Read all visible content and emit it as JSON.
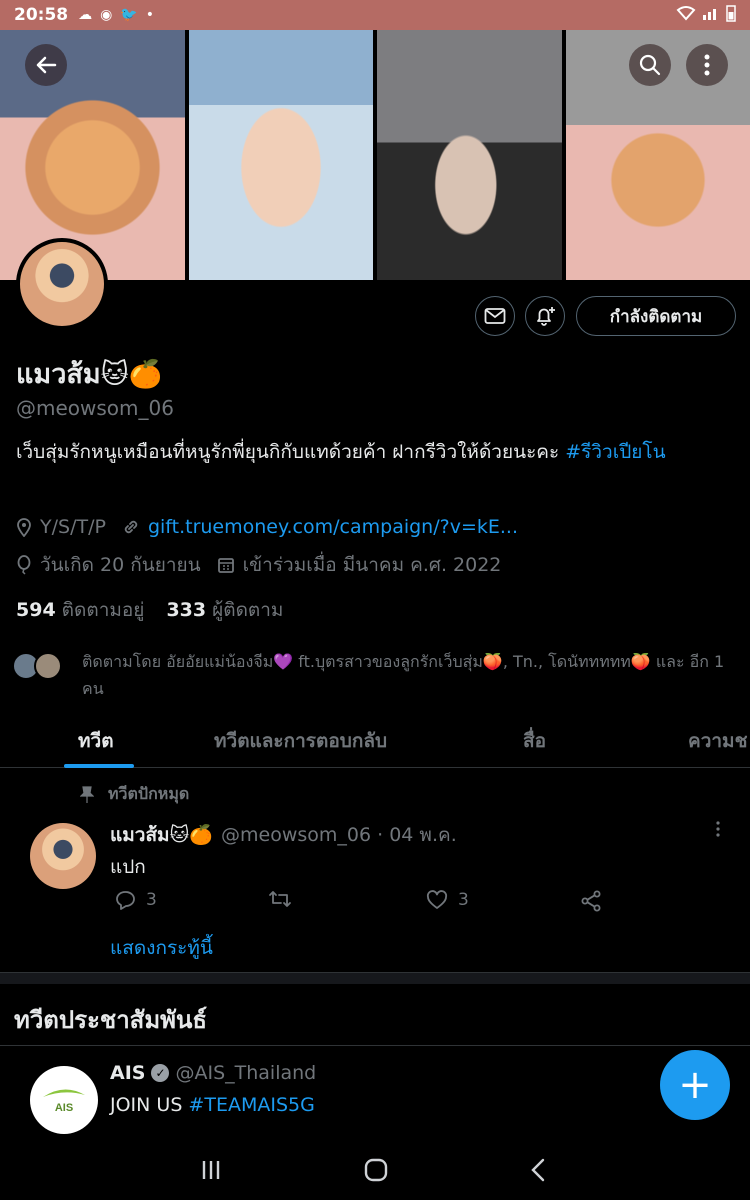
{
  "status_bar": {
    "time": "20:58",
    "left_icons": [
      "weather-icon",
      "chrome-icon",
      "twitter-icon",
      "dot-icon"
    ],
    "right_icons": [
      "wifi-icon",
      "signal-icon",
      "battery-icon"
    ]
  },
  "profile": {
    "name": "แมวส้ม",
    "name_emojis": "🐱🍊",
    "handle": "@meowsom_06",
    "bio_text": "เว็บสุ่มรักหนูเหมือนที่หนูรักพี่ยุนกิกับแทด้วยค้า ฝากรีวิวให้ด้วยนะคะ ",
    "bio_hashtag": "#รีวิวเปียโน",
    "location": "Y/S/T/P",
    "website": "gift.truemoney.com/campaign/?v=kE...",
    "birthday": "วันเกิด 20 กันยายน",
    "joined": "เข้าร่วมเมื่อ มีนาคม ค.ศ. 2022",
    "following_count": "594",
    "following_label": "ติดตามอยู่",
    "followers_count": "333",
    "followers_label": "ผู้ติดตาม",
    "followed_by": "ติดตามโดย อัยอัยแม่น้องจีม💜 ft.บุตรสาวของลูกรักเว็บสุ่ม🍑, Tn., โดนัททททท🍑 และ อีก 1 คน",
    "following_button": "กำลังติดตาม"
  },
  "tabs": [
    {
      "label": "ทวีต",
      "active": true
    },
    {
      "label": "ทวีตและการตอบกลับ",
      "active": false
    },
    {
      "label": "สื่อ",
      "active": false
    },
    {
      "label": "ความช",
      "active": false
    }
  ],
  "pinned_tweet": {
    "pinned_label": "ทวีตปักหมุด",
    "author_name": "แมวส้ม🐱🍊",
    "meta": "@meowsom_06 · 04 พ.ค.",
    "text": "แปก",
    "reply_count": "3",
    "retweet_count": "",
    "like_count": "3",
    "show_thread": "แสดงกระทู้นี้"
  },
  "promoted": {
    "section_title": "ทวีตประชาสัมพันธ์",
    "author_name": "AIS",
    "handle": "@AIS_Thailand",
    "text_plain": "JOIN US ",
    "text_hashtag": "#TEAMAIS5G",
    "logo_text": "AIS"
  },
  "fab_label": "+",
  "nav": {
    "recents": "|||",
    "home": "○",
    "back": "‹"
  },
  "colors": {
    "accent": "#1d9bf0",
    "status_bar": "#b56b64",
    "muted": "#71767b"
  }
}
